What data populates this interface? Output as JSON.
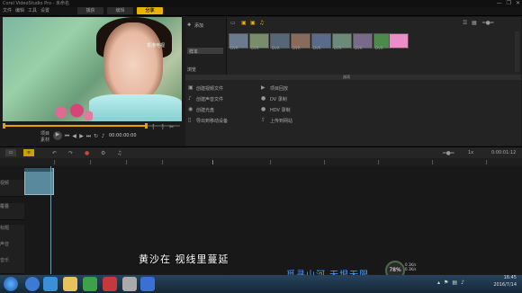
{
  "window": {
    "title": "Corel VideoStudio Pro - 未命名",
    "controls": [
      "—",
      "❐",
      "✕"
    ]
  },
  "menu": {
    "items": [
      "文件",
      "编辑",
      "工具",
      "设置"
    ]
  },
  "steps": {
    "tabs": [
      {
        "label": "捕获",
        "active": false
      },
      {
        "label": "编辑",
        "active": false
      },
      {
        "label": "分享",
        "active": true
      }
    ]
  },
  "preview": {
    "watermark": "香港电视",
    "mode_labels": [
      "项目",
      "素材"
    ],
    "timecode": "00:00:00:00"
  },
  "library": {
    "side": {
      "add": "添加",
      "items": [
        "样本"
      ],
      "browse": "浏览"
    },
    "thumbnails": [
      {
        "caption": "DVR",
        "color": "#6a7b8f"
      },
      {
        "caption": "DVR",
        "color": "#7a8d6a"
      },
      {
        "caption": "DVR",
        "color": "#556677"
      },
      {
        "caption": "DVR",
        "color": "#8a6a5a"
      },
      {
        "caption": "DVR",
        "color": "#5a6a8a"
      },
      {
        "caption": "DVR",
        "color": "#6a8a7a"
      },
      {
        "caption": "DVR",
        "color": "#7a6a8a"
      },
      {
        "caption": "DVR",
        "color": "#4a8a4a"
      },
      {
        "caption": "",
        "color": "#e88fc8"
      }
    ],
    "section_label": "选项",
    "options_left": [
      "创建视频文件",
      "创建声音文件",
      "创建光盘",
      "导出到移动设备"
    ],
    "options_right": [
      "项目回放",
      "DV 录制",
      "HDV 录制",
      "上传到网站"
    ]
  },
  "timeline": {
    "time": "0:00:01:12",
    "zoom": "1x",
    "track_labels": [
      "视频",
      "覆叠",
      "标题",
      "声音",
      "音乐"
    ]
  },
  "subtitles": {
    "main": "黄沙在 视线里蔓延",
    "secondary": "觅寻山河 无垠无限"
  },
  "badge": {
    "value": "78%",
    "info": [
      "0.1K/s",
      "0.1K/s"
    ]
  },
  "taskbar": {
    "clock_time": "16:45",
    "clock_date": "2016/7/14"
  }
}
